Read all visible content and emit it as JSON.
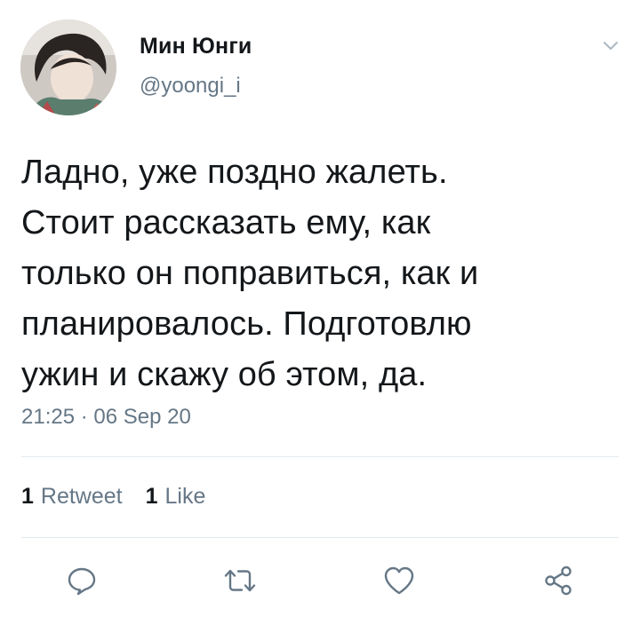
{
  "tweet": {
    "author": {
      "display_name": "Мин Юнги",
      "handle": "@yoongi_i"
    },
    "text": "Ладно, уже поздно жалеть.\nСтоит рассказать ему, как\nтолько он поправиться, как и\nпланировалось. Подготовлю\nужин и скажу об этом, да.",
    "timestamp": "21:25 · 06 Sep 20",
    "stats": {
      "retweets_count": "1",
      "retweets_label": "Retweet",
      "likes_count": "1",
      "likes_label": "Like"
    }
  },
  "icons": {
    "menu": "chevron-down-icon",
    "reply": "reply-icon",
    "retweet": "retweet-icon",
    "like": "heart-icon",
    "share": "share-icon"
  },
  "colors": {
    "text_primary": "#14171a",
    "text_secondary": "#657786",
    "divider": "#e1e8ed",
    "icon": "#657786"
  }
}
